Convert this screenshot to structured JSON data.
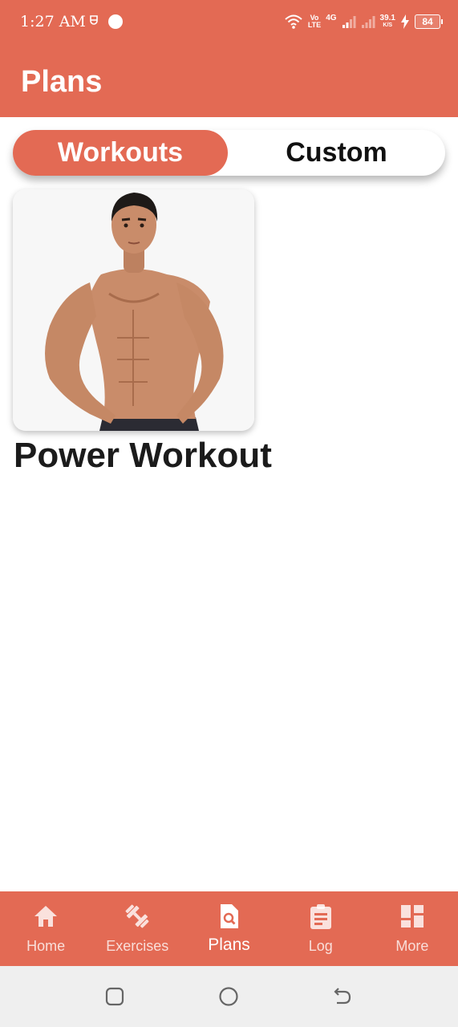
{
  "status_bar": {
    "time": "1:27 AM",
    "network_top": "Vo",
    "network_bottom": "LTE",
    "net_type": "4G",
    "speed_value": "39.1",
    "speed_unit": "K/S",
    "battery": "84",
    "icons": [
      "sim-icon",
      "record-dot-icon",
      "wifi-icon",
      "signal-icon",
      "signal-icon",
      "charging-icon",
      "battery-icon"
    ]
  },
  "app_bar": {
    "title": "Plans"
  },
  "tabs": [
    {
      "label": "Workouts",
      "active": true
    },
    {
      "label": "Custom",
      "active": false
    }
  ],
  "plans": [
    {
      "title": "Power Workout",
      "image": "shirtless-man-photo"
    }
  ],
  "bottom_nav": [
    {
      "label": "Home",
      "icon": "home-icon",
      "active": false
    },
    {
      "label": "Exercises",
      "icon": "dumbbell-icon",
      "active": false
    },
    {
      "label": "Plans",
      "icon": "search-document-icon",
      "active": true
    },
    {
      "label": "Log",
      "icon": "clipboard-icon",
      "active": false
    },
    {
      "label": "More",
      "icon": "dashboard-icon",
      "active": false
    }
  ],
  "system_nav": [
    "recent-apps-icon",
    "home-circle-icon",
    "back-icon"
  ],
  "colors": {
    "primary": "#e36a54",
    "background": "#ffffff",
    "text": "#1b1b1b",
    "system_nav": "#efefef"
  }
}
